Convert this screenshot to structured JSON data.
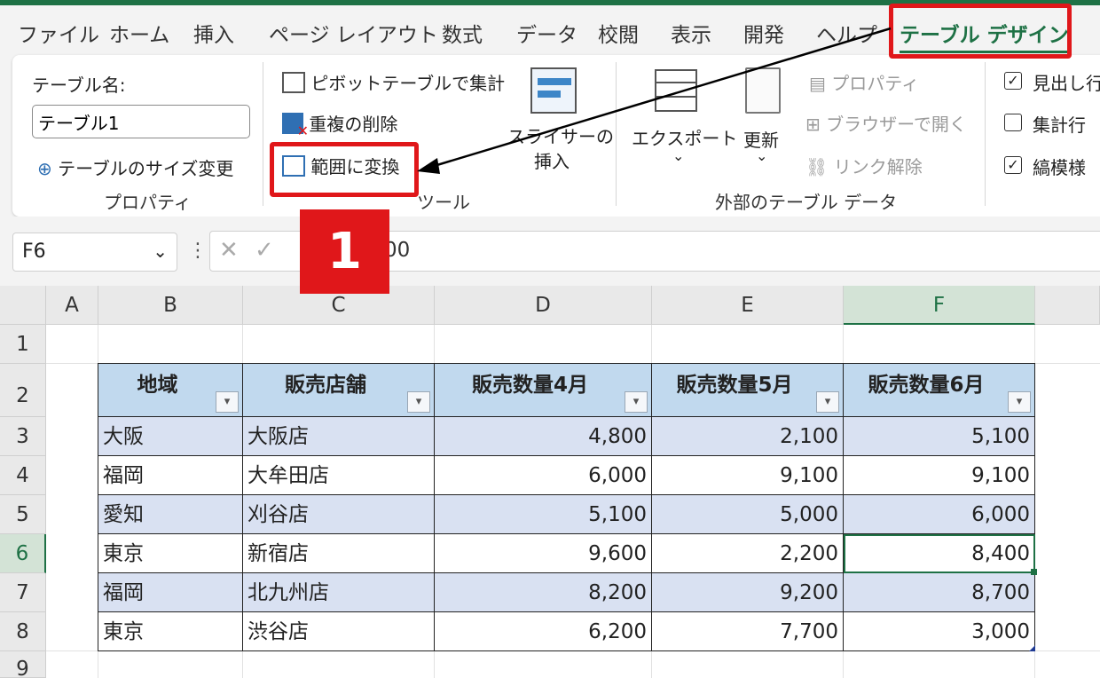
{
  "tabs": [
    "ファイル",
    "ホーム",
    "挿入",
    "ページ レイアウト",
    "数式",
    "データ",
    "校閲",
    "表示",
    "開発",
    "ヘルプ",
    "テーブル デザイン"
  ],
  "active_tab": "テーブル デザイン",
  "ribbon": {
    "properties": {
      "table_name_label": "テーブル名:",
      "table_name_value": "テーブル1",
      "resize_label": "テーブルのサイズ変更",
      "group_label": "プロパティ"
    },
    "tools": {
      "pivot_label": "ピボットテーブルで集計",
      "remove_dup_label": "重複の削除",
      "convert_label": "範囲に変換",
      "slicer_label_1": "スライサーの",
      "slicer_label_2": "挿入",
      "group_label": "ツール"
    },
    "external": {
      "export_label": "エクスポート",
      "refresh_label": "更新",
      "properties_label": "プロパティ",
      "open_browser_label": "ブラウザーで開く",
      "unlink_label": "リンク解除",
      "group_label": "外部のテーブル データ"
    },
    "style_options": {
      "header_row_label": "見出し行",
      "total_row_label": "集計行",
      "banded_rows_label": "縞模様",
      "header_row_checked": true,
      "total_row_checked": false,
      "banded_rows_checked": true
    }
  },
  "formula_bar": {
    "name_box": "F6",
    "formula_fragment": "00"
  },
  "annotation": {
    "step_number": "1"
  },
  "grid": {
    "columns": [
      "A",
      "B",
      "C",
      "D",
      "E",
      "F"
    ],
    "rows": [
      "1",
      "2",
      "3",
      "4",
      "5",
      "6",
      "7",
      "8",
      "9"
    ],
    "selected_cell": "F6"
  },
  "table": {
    "headers": [
      "地域",
      "販売店舗",
      "販売数量4月",
      "販売数量5月",
      "販売数量6月"
    ],
    "rows": [
      [
        "大阪",
        "大阪店",
        "4,800",
        "2,100",
        "5,100"
      ],
      [
        "福岡",
        "大牟田店",
        "6,000",
        "9,100",
        "9,100"
      ],
      [
        "愛知",
        "刈谷店",
        "5,100",
        "5,000",
        "6,000"
      ],
      [
        "東京",
        "新宿店",
        "9,600",
        "2,200",
        "8,400"
      ],
      [
        "福岡",
        "北九州店",
        "8,200",
        "9,200",
        "8,700"
      ],
      [
        "東京",
        "渋谷店",
        "6,200",
        "7,700",
        "3,000"
      ]
    ]
  },
  "colors": {
    "excel_green": "#1e7145",
    "annotation_red": "#e0171a",
    "table_header": "#c1d9ee",
    "table_band": "#d9e1f2"
  }
}
